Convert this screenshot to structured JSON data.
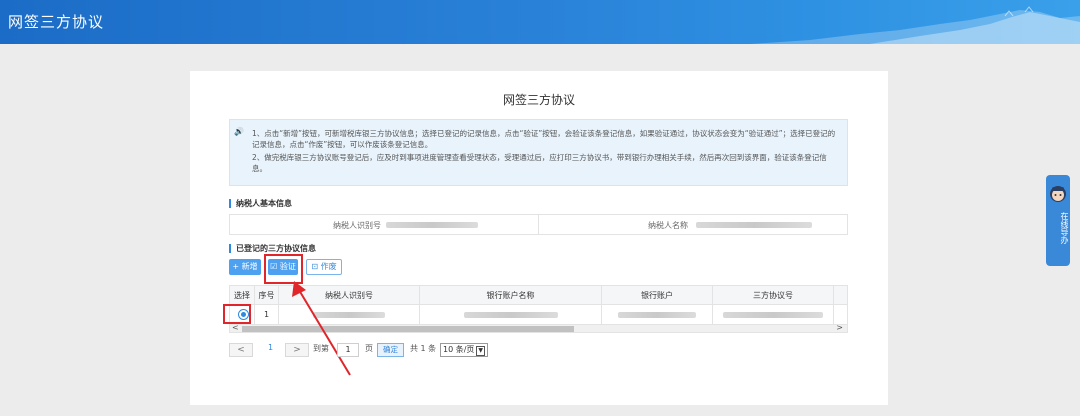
{
  "header": {
    "title": "网签三方协议"
  },
  "page": {
    "title": "网签三方协议"
  },
  "notice": {
    "line1": "1、点击“新增”按钮，可新增税库银三方协议信息；选择已登记的记录信息，点击“验证”按钮，会验证该条登记信息，如果验证通过，协议状态会变为“验证通过”；选择已登记的记录信息，点击“作废”按钮，可以作废该条登记信息。",
    "line2": "2、做完税库银三方协议账号登记后，应及时到事项进度管理查看受理状态，受理通过后，应打印三方协议书，带到银行办理相关手续，然后再次回到该界面，验证该条登记信息。"
  },
  "basic_info": {
    "heading": "纳税人基本信息",
    "taxpayer_id_label": "纳税人识别号",
    "taxpayer_name_label": "纳税人名称"
  },
  "registered": {
    "heading": "已登记的三方协议信息",
    "add_label": "+ 新增",
    "verify_label": "☑ 验证",
    "void_label": "⊡ 作废"
  },
  "table": {
    "columns": [
      "选择",
      "序号",
      "纳税人识别号",
      "银行账户名称",
      "银行账户",
      "三方协议号"
    ],
    "rows": [
      {
        "index": "1",
        "selected": true
      }
    ]
  },
  "pager": {
    "current_page": "1",
    "goto_label": "到第",
    "goto_value": "1",
    "page_unit": "页",
    "confirm_label": "确定",
    "total_label": "共 1 条",
    "page_size": "10 条/页"
  },
  "side_widget": {
    "label": "在线导办"
  },
  "colors": {
    "brand_blue": "#2f89e0",
    "highlight_red": "#e0262a"
  }
}
